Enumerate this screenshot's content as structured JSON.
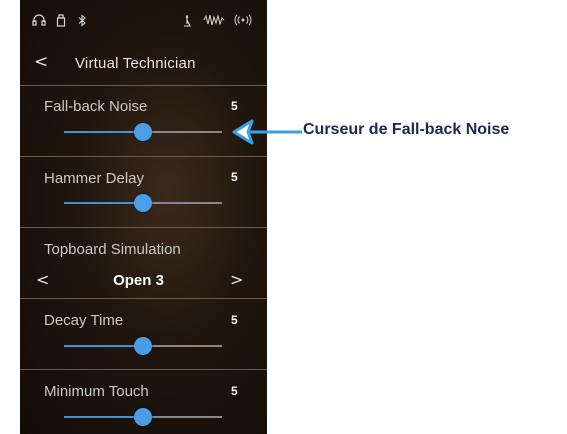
{
  "header": {
    "back_glyph": "<",
    "title": "Virtual Technician"
  },
  "status_icons": [
    "headphones-icon",
    "usb-icon",
    "bluetooth-icon",
    "metronome-icon",
    "recorder-icon",
    "wireless-icon"
  ],
  "settings": [
    {
      "label": "Fall-back Noise",
      "value": "5",
      "level": 0.5
    },
    {
      "label": "Hammer Delay",
      "value": "5",
      "level": 0.5
    },
    {
      "label": "Decay Time",
      "value": "5",
      "level": 0.5
    },
    {
      "label": "Minimum Touch",
      "value": "5",
      "level": 0.5
    }
  ],
  "topboard": {
    "label": "Topboard Simulation",
    "value": "Open 3",
    "prev_glyph": "<",
    "next_glyph": ">"
  },
  "annotation": {
    "text": "Curseur de Fall-back Noise"
  },
  "colors": {
    "accent": "#4a9ee6",
    "callout": "#1a2a57",
    "arrow": "#3aa0e8"
  }
}
